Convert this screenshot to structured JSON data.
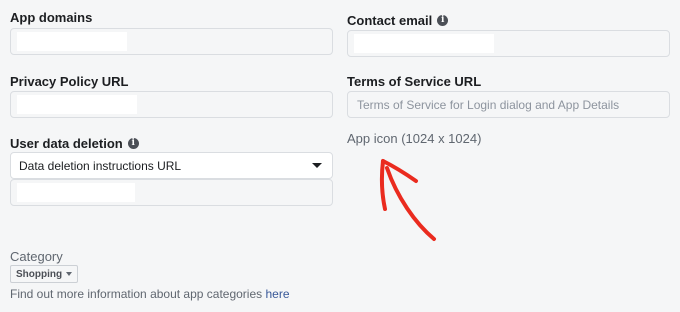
{
  "fields": {
    "app_domains": {
      "label": "App domains",
      "value": ""
    },
    "contact_email": {
      "label": "Contact email",
      "value": ""
    },
    "privacy_policy_url": {
      "label": "Privacy Policy URL",
      "value": ""
    },
    "terms_of_service_url": {
      "label": "Terms of Service URL",
      "value": "",
      "placeholder": "Terms of Service for Login dialog and App Details"
    },
    "user_data_deletion": {
      "label": "User data deletion",
      "selected_option": "Data deletion instructions URL",
      "value": ""
    }
  },
  "app_icon": {
    "label": "App icon (1024 x 1024)"
  },
  "category": {
    "label": "Category",
    "selected": "Shopping",
    "help_text": "Find out more information about app categories",
    "help_link": "here"
  },
  "icons": {
    "info": "info-icon",
    "dropdown": "chevron-down-icon"
  },
  "annotation": {
    "type": "red-hand-drawn-arrow",
    "color": "#ea2b1f"
  },
  "colors": {
    "background": "#f5f6f7",
    "link": "#385898",
    "border": "#dadde1"
  }
}
